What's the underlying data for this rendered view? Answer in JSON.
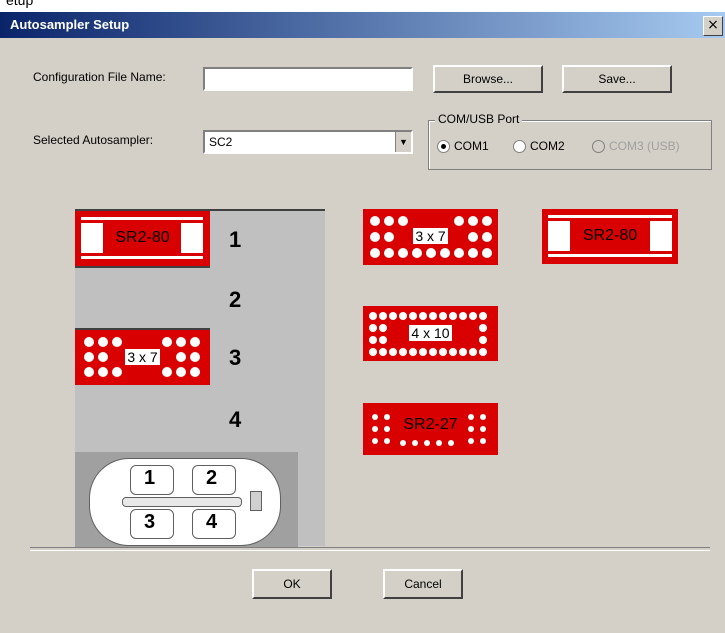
{
  "top_fragment": "etup",
  "window": {
    "title": "Autosampler Setup",
    "close_glyph": "×"
  },
  "config": {
    "label": "Configuration File Name:",
    "value": ""
  },
  "browse_button": "Browse...",
  "save_button": "Save...",
  "autosampler": {
    "label": "Selected Autosampler:",
    "selected": "SC2"
  },
  "com_port": {
    "title": "COM/USB Port",
    "options": [
      {
        "label": "COM1",
        "selected": true,
        "enabled": true
      },
      {
        "label": "COM2",
        "selected": false,
        "enabled": true
      },
      {
        "label": "COM3 (USB)",
        "selected": false,
        "enabled": false
      }
    ]
  },
  "slots": [
    "1",
    "2",
    "3",
    "4"
  ],
  "sampler_racks": {
    "slot1": "SR2-80",
    "slot3": "3 x 7"
  },
  "available_racks": [
    "3 x 7",
    "SR2-80",
    "4 x 10",
    "SR2-27"
  ],
  "base_positions": [
    "1",
    "2",
    "3",
    "4"
  ],
  "ok_button": "OK",
  "cancel_button": "Cancel",
  "colors": {
    "rack_red": "#d80000",
    "title_bar": "#0a246a",
    "dialog_bg": "#d4d0c8"
  }
}
